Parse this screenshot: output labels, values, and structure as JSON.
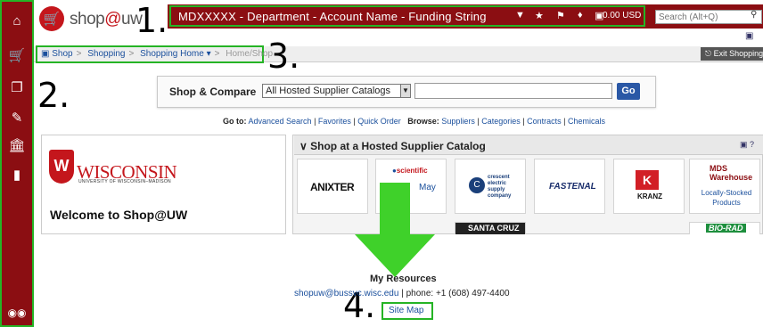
{
  "topbar": {
    "funding_string": "MDXXXXX - Department - Account Name - Funding String",
    "cart_total": "0.00 USD",
    "search_placeholder": "Search (Alt+Q)"
  },
  "logo": {
    "text_pre": "shop",
    "text_at": "@",
    "text_post": "uw"
  },
  "breadcrumb": {
    "items": [
      "Shop",
      "Shopping",
      "Shopping Home",
      "Home/Shop"
    ],
    "exit_label": "Exit Shopping"
  },
  "markers": [
    "1.",
    "2.",
    "3.",
    "4."
  ],
  "compare": {
    "label": "Shop & Compare",
    "selected_catalog": "All Hosted Supplier Catalogs",
    "go_label": "Go"
  },
  "goto": {
    "goto_label": "Go to:",
    "goto_links": [
      "Advanced Search",
      "Favorites",
      "Quick Order"
    ],
    "browse_label": "Browse:",
    "browse_links": [
      "Suppliers",
      "Categories",
      "Contracts",
      "Chemicals"
    ]
  },
  "welcome": {
    "crest_letter": "W",
    "university": "WISCONSIN",
    "university_sub": "UNIVERSITY OF WISCONSIN–MADISON",
    "title": "Welcome to Shop@UW"
  },
  "suppliers": {
    "title": "Shop at a Hosted Supplier Catalog",
    "tiles": [
      {
        "name": "ANIXTER"
      },
      {
        "name": "scientific",
        "sub": "May"
      },
      {
        "name": "crescent electric supply company"
      },
      {
        "name": "FASTENAL"
      },
      {
        "name": "KRANZ"
      },
      {
        "name": "MDS Warehouse",
        "sub": "Locally-Stocked Products"
      }
    ],
    "row2": [
      "SANTA CRUZ",
      "BIO-RAD"
    ]
  },
  "resources": {
    "title": "My Resources",
    "email": "shopuw@bussvc.wisc.edu",
    "phone": "| phone: +1 (608) 497-4400",
    "site_map": "Site Map"
  },
  "colors": {
    "brand_red": "#8b0e12",
    "highlight_green": "#25b425",
    "link_blue": "#1a4f9c"
  }
}
